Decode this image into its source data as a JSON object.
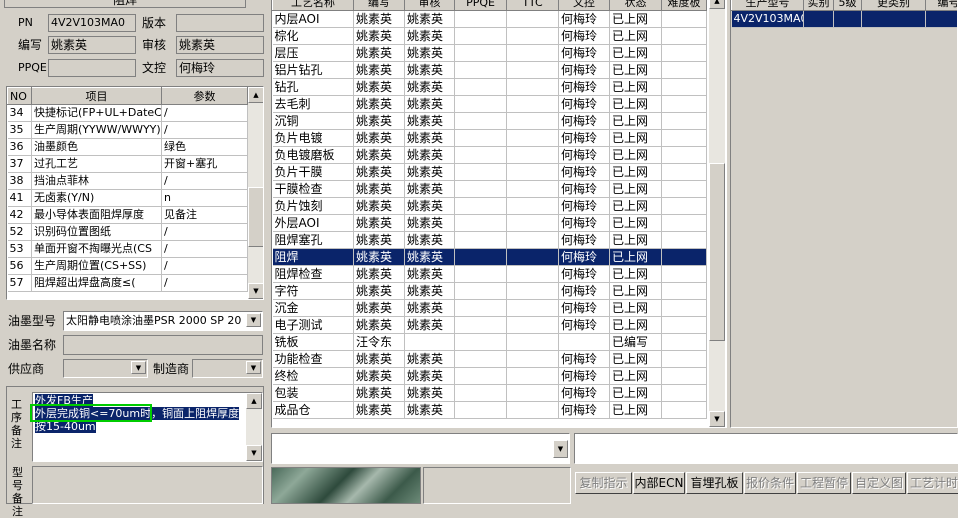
{
  "header": {
    "section_title": "阻焊",
    "pn_label": "PN",
    "pn_value": "4V2V103MA0",
    "version_label": "版本",
    "version_value": "",
    "author_label": "编写",
    "author_value": "姚素英",
    "reviewer_label": "审核",
    "reviewer_value": "姚素英",
    "ppqe_label": "PPQE",
    "ppqe_value": "",
    "doc_control_label": "文控",
    "doc_control_value": "何梅玲"
  },
  "params": {
    "columns": [
      "NO",
      "项目",
      "参数"
    ],
    "rows": [
      [
        "34",
        "快捷标记(FP+UL+DateCo",
        "/"
      ],
      [
        "35",
        "生产周期(YYWW/WWYY)",
        "/"
      ],
      [
        "36",
        "油墨颜色",
        "绿色"
      ],
      [
        "37",
        "过孔工艺",
        "开窗+塞孔"
      ],
      [
        "38",
        "挡油点菲林",
        "/"
      ],
      [
        "41",
        "无卤素(Y/N)",
        "n"
      ],
      [
        "42",
        "最小导体表面阻焊厚度",
        "见备注"
      ],
      [
        "52",
        "识别码位置图纸",
        "/"
      ],
      [
        "53",
        "单面开窗不掏曝光点(CS",
        "/"
      ],
      [
        "56",
        "生产周期位置(CS+SS)",
        "/"
      ],
      [
        "57",
        "阻焊超出焊盘高度≤(",
        "/"
      ]
    ]
  },
  "ink": {
    "model_label": "油墨型号",
    "model_value": "太阳静电喷涂油墨PSR 2000 SP 20",
    "name_label": "油墨名称",
    "name_value": "",
    "supplier_label": "供应商",
    "supplier_value": "",
    "maker_label": "制造商",
    "maker_value": ""
  },
  "notes": {
    "label": "工序备注",
    "line1": "外发FB生产",
    "line2": "外层完成铜<=70um时，铜面上阻焊厚度",
    "line3": "按15-40um",
    "model_label": "型号备注"
  },
  "process": {
    "columns": [
      "工艺名称",
      "编写",
      "审核",
      "PPQE",
      "TTC",
      "文控",
      "状态",
      "难度板"
    ],
    "rows": [
      [
        "内层AOI",
        "姚素英",
        "姚素英",
        "",
        "",
        "何梅玲",
        "已上网",
        ""
      ],
      [
        "棕化",
        "姚素英",
        "姚素英",
        "",
        "",
        "何梅玲",
        "已上网",
        ""
      ],
      [
        "层压",
        "姚素英",
        "姚素英",
        "",
        "",
        "何梅玲",
        "已上网",
        ""
      ],
      [
        "铝片钻孔",
        "姚素英",
        "姚素英",
        "",
        "",
        "何梅玲",
        "已上网",
        ""
      ],
      [
        "钻孔",
        "姚素英",
        "姚素英",
        "",
        "",
        "何梅玲",
        "已上网",
        ""
      ],
      [
        "去毛刺",
        "姚素英",
        "姚素英",
        "",
        "",
        "何梅玲",
        "已上网",
        ""
      ],
      [
        "沉铜",
        "姚素英",
        "姚素英",
        "",
        "",
        "何梅玲",
        "已上网",
        ""
      ],
      [
        "负片电镀",
        "姚素英",
        "姚素英",
        "",
        "",
        "何梅玲",
        "已上网",
        ""
      ],
      [
        "负电镀磨板",
        "姚素英",
        "姚素英",
        "",
        "",
        "何梅玲",
        "已上网",
        ""
      ],
      [
        "负片干膜",
        "姚素英",
        "姚素英",
        "",
        "",
        "何梅玲",
        "已上网",
        ""
      ],
      [
        "干膜检查",
        "姚素英",
        "姚素英",
        "",
        "",
        "何梅玲",
        "已上网",
        ""
      ],
      [
        "负片蚀刻",
        "姚素英",
        "姚素英",
        "",
        "",
        "何梅玲",
        "已上网",
        ""
      ],
      [
        "外层AOI",
        "姚素英",
        "姚素英",
        "",
        "",
        "何梅玲",
        "已上网",
        ""
      ],
      [
        "阻焊塞孔",
        "姚素英",
        "姚素英",
        "",
        "",
        "何梅玲",
        "已上网",
        ""
      ],
      [
        "阻焊",
        "姚素英",
        "姚素英",
        "",
        "",
        "何梅玲",
        "已上网",
        ""
      ],
      [
        "阻焊检查",
        "姚素英",
        "姚素英",
        "",
        "",
        "何梅玲",
        "已上网",
        ""
      ],
      [
        "字符",
        "姚素英",
        "姚素英",
        "",
        "",
        "何梅玲",
        "已上网",
        ""
      ],
      [
        "沉金",
        "姚素英",
        "姚素英",
        "",
        "",
        "何梅玲",
        "已上网",
        ""
      ],
      [
        "电子测试",
        "姚素英",
        "姚素英",
        "",
        "",
        "何梅玲",
        "已上网",
        ""
      ],
      [
        "铣板",
        "汪令东",
        "",
        "",
        "",
        "",
        "已编写",
        ""
      ],
      [
        "功能检查",
        "姚素英",
        "姚素英",
        "",
        "",
        "何梅玲",
        "已上网",
        ""
      ],
      [
        "终检",
        "姚素英",
        "姚素英",
        "",
        "",
        "何梅玲",
        "已上网",
        ""
      ],
      [
        "包装",
        "姚素英",
        "姚素英",
        "",
        "",
        "何梅玲",
        "已上网",
        ""
      ],
      [
        "成品仓",
        "姚素英",
        "姚素英",
        "",
        "",
        "何梅玲",
        "已上网",
        ""
      ]
    ],
    "selected_index": 14
  },
  "models": {
    "columns": [
      "生产型号",
      "实别",
      "5级",
      "更类别",
      "编号"
    ],
    "rows": [
      [
        "4V2V103MA0",
        "",
        "",
        "",
        ""
      ]
    ]
  },
  "toolbar": {
    "buttons": [
      {
        "label": "复制指示",
        "enabled": false
      },
      {
        "label": "内部ECN",
        "enabled": true
      },
      {
        "label": "盲埋孔板",
        "enabled": true
      },
      {
        "label": "报价条件",
        "enabled": false
      },
      {
        "label": "工程暂停",
        "enabled": false
      },
      {
        "label": "自定义图",
        "enabled": false
      },
      {
        "label": "工艺计时",
        "enabled": false
      }
    ]
  },
  "colors": {
    "selection": "#0a246a",
    "highlight_box": "#00cc00",
    "window_bg": "#d4d0c8"
  }
}
